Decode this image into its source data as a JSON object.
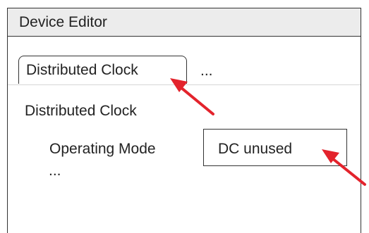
{
  "window": {
    "title": "Device Editor"
  },
  "tabs": {
    "active_label": "Distributed Clock",
    "more_label": "..."
  },
  "section": {
    "heading": "Distributed Clock",
    "field_label": "Operating Mode",
    "field_value": "DC unused",
    "more_label": "..."
  },
  "annotations": {
    "arrow_color": "#e3232c",
    "arrow_targets": [
      "tab-distributed-clock",
      "operating-mode-field"
    ]
  }
}
